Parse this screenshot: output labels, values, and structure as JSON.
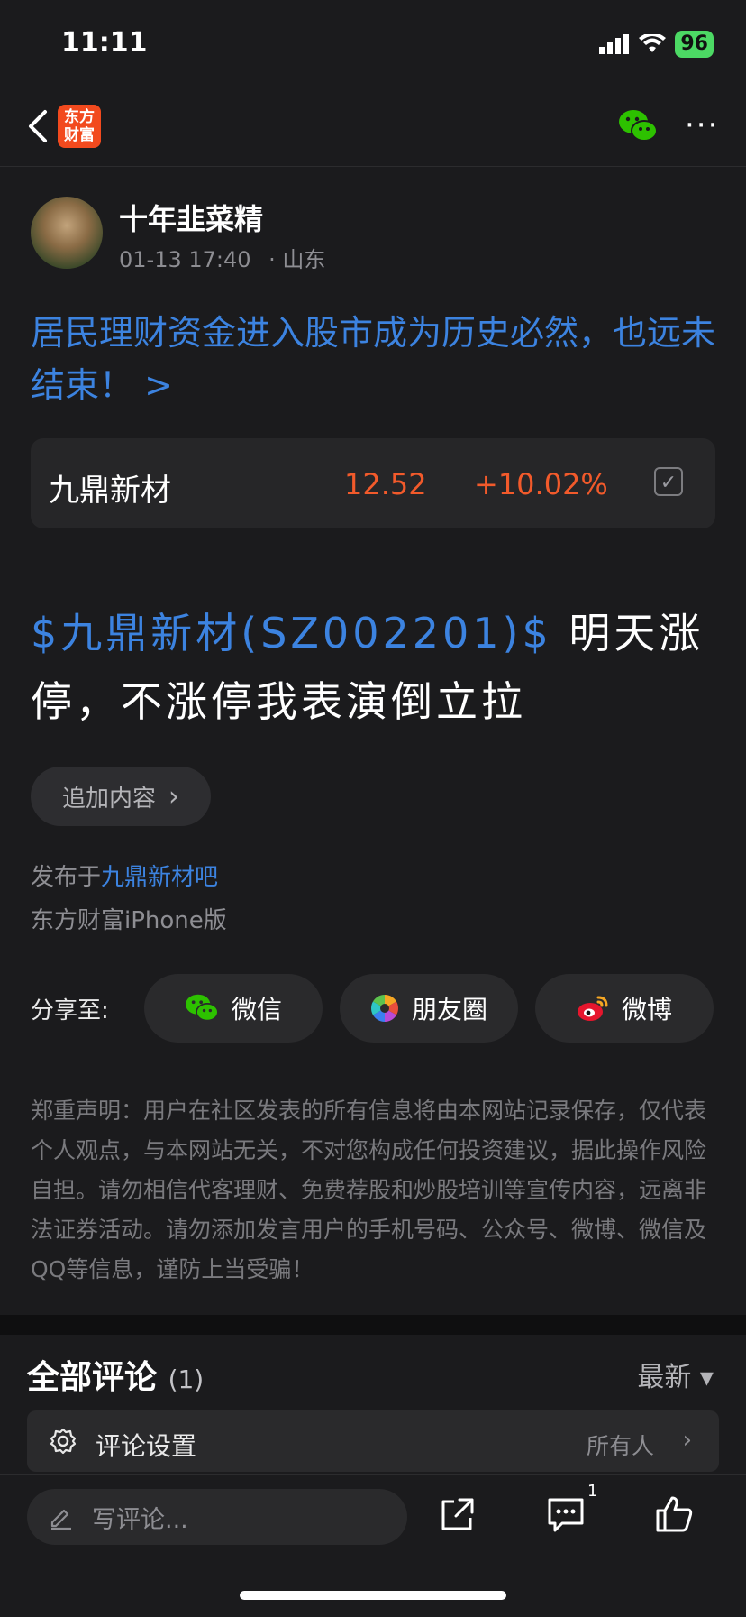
{
  "status_bar": {
    "time": "11:11",
    "battery": "96"
  },
  "nav": {
    "logo_line1": "东方",
    "logo_line2": "财富",
    "more": "···"
  },
  "author": {
    "name": "十年韭菜精",
    "datetime": "01-13 17:40",
    "location": "· 山东"
  },
  "article": {
    "title": "居民理财资金进入股市成为历史必然，也远未结束！ >"
  },
  "stock_card": {
    "name": "九鼎新材",
    "price": "12.52",
    "change": "+10.02%",
    "price_color": "#f25a2b"
  },
  "post": {
    "tag": "$九鼎新材(SZ002201)$",
    "text": "  明天涨停，不涨停我表演倒立拉"
  },
  "append_button": {
    "label": "追加内容",
    "chevron": "›"
  },
  "published": {
    "prefix": "发布于",
    "forum": "九鼎新材吧",
    "client": "东方财富iPhone版"
  },
  "share": {
    "label": "分享至:",
    "buttons": [
      {
        "label": "微信",
        "icon": "wechat-icon"
      },
      {
        "label": "朋友圈",
        "icon": "moments-icon"
      },
      {
        "label": "微博",
        "icon": "weibo-icon"
      }
    ]
  },
  "disclaimer": "郑重声明：用户在社区发表的所有信息将由本网站记录保存，仅代表个人观点，与本网站无关，不对您构成任何投资建议，据此操作风险自担。请勿相信代客理财、免费荐股和炒股培训等宣传内容，远离非法证券活动。请勿添加发言用户的手机号码、公众号、微博、微信及QQ等信息，谨防上当受骗！",
  "comments": {
    "title": "全部评论",
    "count": "(1)",
    "sort_label": "最新 ▾",
    "settings_label": "评论设置",
    "settings_value": "所有人",
    "settings_chevron": "›"
  },
  "bottom_bar": {
    "input_placeholder": "写评论...",
    "comment_badge": "1"
  },
  "colors": {
    "accent": "#3c83e0",
    "up": "#f25a2b",
    "wechat": "#2dc100"
  }
}
